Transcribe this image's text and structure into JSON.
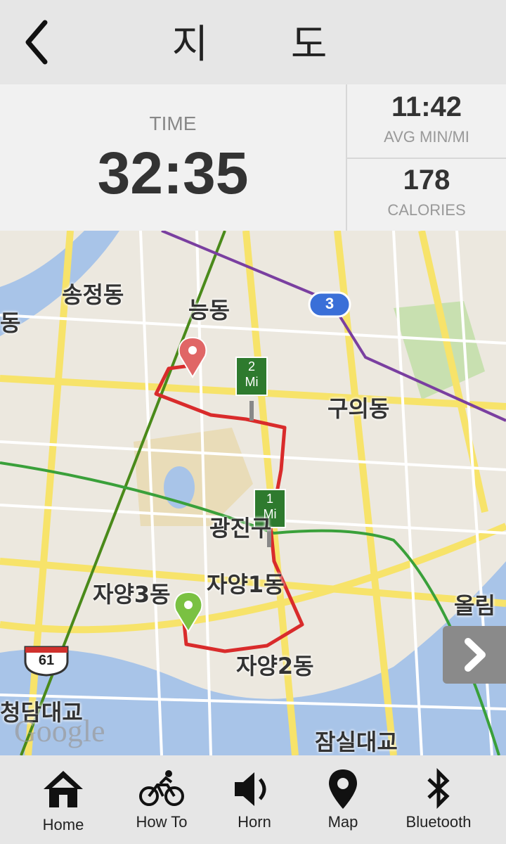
{
  "header": {
    "title": "지 도",
    "back_icon": "chevron-left-icon"
  },
  "stats": {
    "time_label": "TIME",
    "time_value": "32:35",
    "pace_value": "11:42",
    "pace_label": "AVG MIN/MI",
    "calories_value": "178",
    "calories_label": "CALORIES"
  },
  "map": {
    "labels": [
      "송정동",
      "능동",
      "동",
      "구의동",
      "광진구",
      "자양1동",
      "자양3동",
      "올림",
      "자양2동",
      "청담대교",
      "잠실대교"
    ],
    "markers": {
      "mile2": "2\nMi",
      "mile1": "1\nMi",
      "mile2_top": "2",
      "mile2_bottom": "Mi",
      "mile1_top": "1",
      "mile1_bottom": "Mi"
    },
    "route_badge": "3",
    "highway_badge": "61",
    "watermark": "Google",
    "colors": {
      "route": "#d92b2b",
      "start": "#7ac142",
      "end": "#e06666",
      "line7": "#4a9a2a",
      "line5": "#7a3fa0",
      "river": "#a8c4e8"
    }
  },
  "nav": [
    {
      "label": "Home",
      "icon": "home-icon"
    },
    {
      "label": "How To",
      "icon": "bicycle-icon"
    },
    {
      "label": "Horn",
      "icon": "speaker-icon"
    },
    {
      "label": "Map",
      "icon": "map-pin-icon"
    },
    {
      "label": "Bluetooth",
      "icon": "bluetooth-icon"
    }
  ]
}
